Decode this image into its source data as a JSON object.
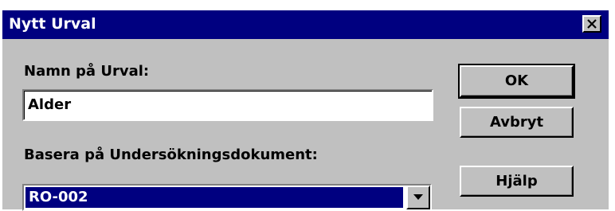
{
  "window": {
    "title": "Nytt Urval",
    "close_icon": "close-icon"
  },
  "form": {
    "name_label": "Namn på Urval:",
    "name_value": "Alder",
    "base_label": "Basera på Undersökningsdokument:",
    "base_selected": "RO-002",
    "dropdown_icon": "chevron-down-icon"
  },
  "buttons": {
    "ok": "OK",
    "cancel": "Avbryt",
    "help": "Hjälp"
  },
  "colors": {
    "titlebar": "#000080",
    "dialog_face": "#c0c0c0",
    "selection": "#000080"
  }
}
